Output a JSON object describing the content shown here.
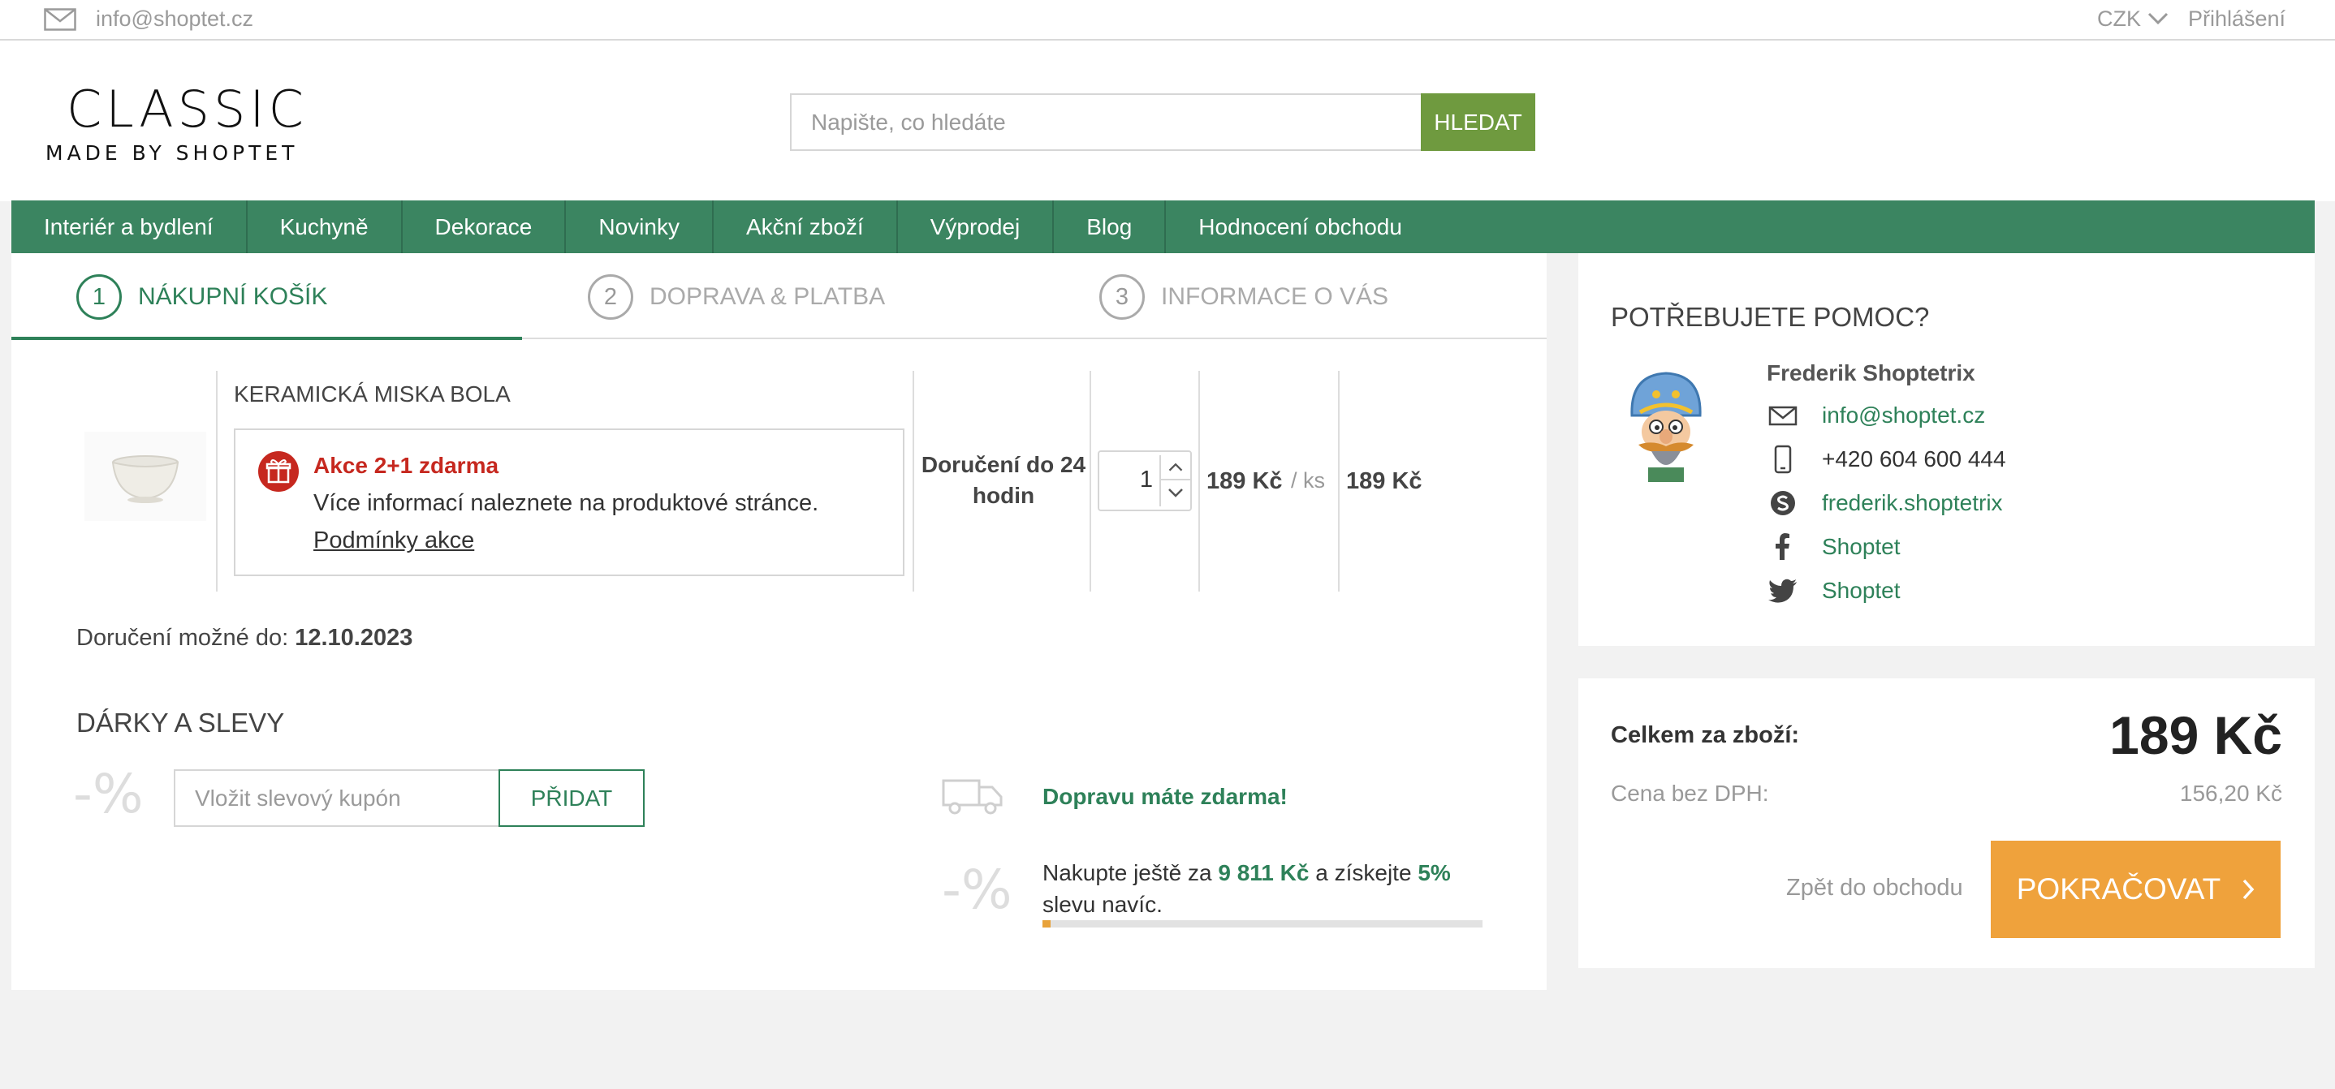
{
  "topbar": {
    "email": "info@shoptet.cz",
    "currency": "CZK",
    "login": "Přihlášení"
  },
  "header": {
    "logo_main": "CLASSIC",
    "logo_sub": "MADE BY SHOPTET",
    "search_placeholder": "Napište, co hledáte",
    "search_button": "HLEDAT"
  },
  "nav": {
    "items": [
      {
        "label": "Interiér a bydlení"
      },
      {
        "label": "Kuchyně"
      },
      {
        "label": "Dekorace"
      },
      {
        "label": "Novinky"
      },
      {
        "label": "Akční zboží"
      },
      {
        "label": "Výprodej"
      },
      {
        "label": "Blog"
      },
      {
        "label": "Hodnocení obchodu"
      }
    ]
  },
  "steps": [
    {
      "number": "1",
      "label": "NÁKUPNÍ KOŠÍK",
      "active": true
    },
    {
      "number": "2",
      "label": "DOPRAVA & PLATBA",
      "active": false
    },
    {
      "number": "3",
      "label": "INFORMACE O VÁS",
      "active": false
    }
  ],
  "cart": {
    "item": {
      "name": "KERAMICKÁ MISKA BOLA",
      "promo_title": "Akce 2+1 zdarma",
      "promo_text": "Více informací naleznete na produktové stránce.",
      "promo_link": "Podmínky akce",
      "delivery": "Doručení do 24 hodin",
      "quantity": "1",
      "unit_price": "189 Kč",
      "per_unit": "/ ks",
      "total_price": "189 Kč"
    },
    "delivery_possible_label": "Doručení možné do:",
    "delivery_possible_date": "12.10.2023"
  },
  "gifts": {
    "title": "DÁRKY A SLEVY",
    "percent_symbol": "-%",
    "coupon_placeholder": "Vložit slevový kupón",
    "add_button": "PŘIDAT",
    "free_shipping": "Dopravu máte zdarma!",
    "more_text_pre": "Nakupte ještě za",
    "more_amount": "9 811 Kč",
    "more_text_mid": "a získejte",
    "more_percent": "5%",
    "more_text_post": "slevu navíc.",
    "progress_fraction": 0.019
  },
  "help": {
    "title": "POTŘEBUJETE POMOC?",
    "agent_name": "Frederik Shoptetrix",
    "contacts": [
      {
        "icon": "envelope-icon",
        "text": "info@shoptet.cz"
      },
      {
        "icon": "phone-icon",
        "text": "+420 604 600 444"
      },
      {
        "icon": "skype-icon",
        "text": "frederik.shoptetrix"
      },
      {
        "icon": "facebook-icon",
        "text": "Shoptet"
      },
      {
        "icon": "twitter-icon",
        "text": "Shoptet"
      }
    ]
  },
  "summary": {
    "total_label": "Celkem za zboží:",
    "total_value": "189 Kč",
    "net_label": "Cena bez DPH:",
    "net_value": "156,20 Kč",
    "back_link": "Zpět do obchodu",
    "continue_button": "POKRAČOVAT"
  },
  "colors": {
    "brand_green": "#3b8561",
    "search_button": "#6f9a3f",
    "promo_red": "#c6281f",
    "continue_orange": "#efa23c"
  }
}
